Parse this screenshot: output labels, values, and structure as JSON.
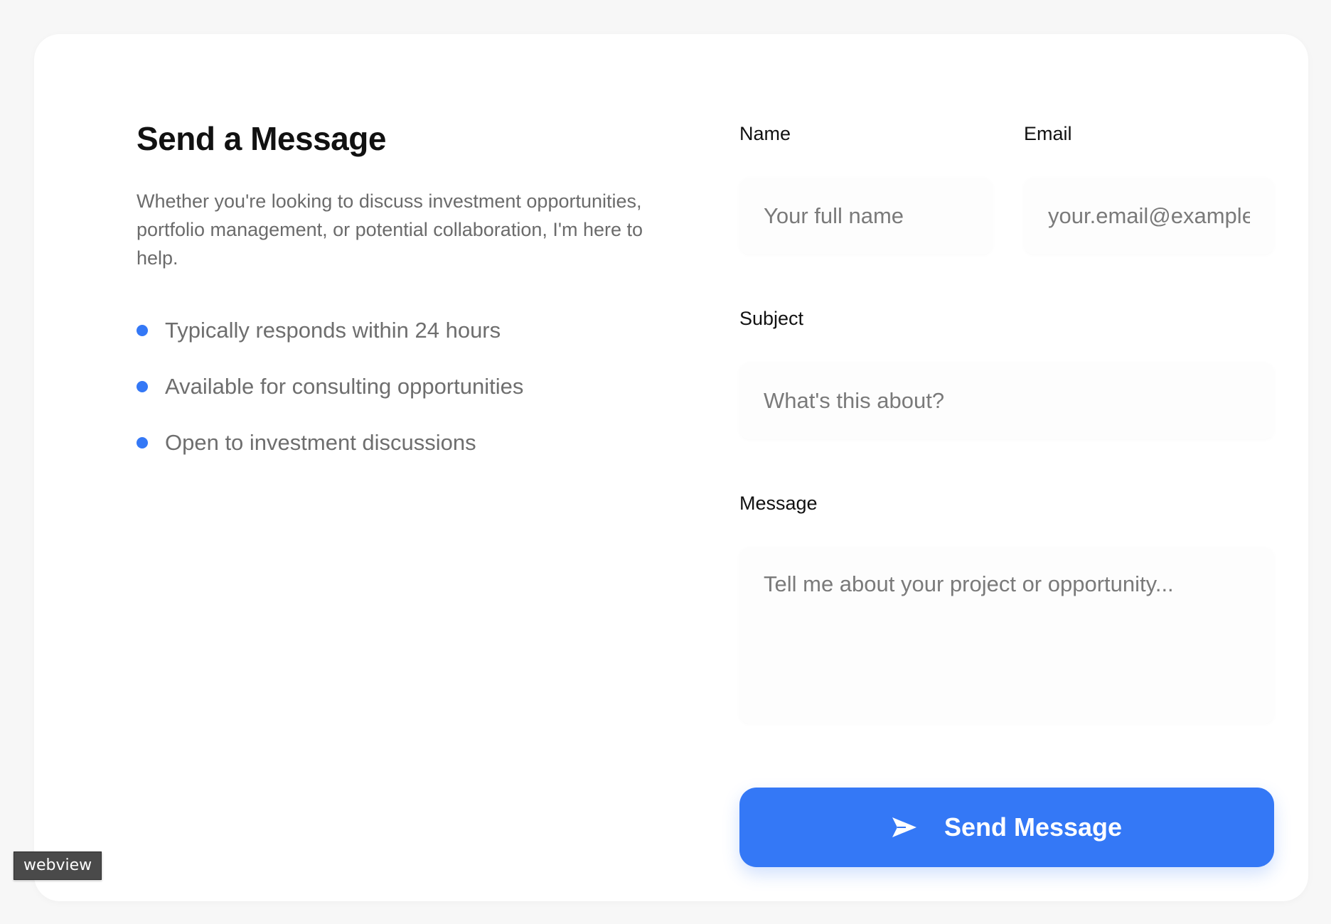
{
  "contact": {
    "title": "Send a Message",
    "description": "Whether you're looking to discuss investment opportunities, portfolio management, or potential collaboration, I'm here to help.",
    "bullets": [
      "Typically responds within 24 hours",
      "Available for consulting opportunities",
      "Open to investment discussions"
    ],
    "accent_color": "#3478f6"
  },
  "form": {
    "name": {
      "label": "Name",
      "placeholder": "Your full name"
    },
    "email": {
      "label": "Email",
      "placeholder": "your.email@example.com"
    },
    "subject": {
      "label": "Subject",
      "placeholder": "What's this about?"
    },
    "message": {
      "label": "Message",
      "placeholder": "Tell me about your project or opportunity..."
    },
    "submit": {
      "label": "Send Message",
      "icon": "send-icon"
    }
  },
  "overlay": {
    "tag": "webview"
  }
}
